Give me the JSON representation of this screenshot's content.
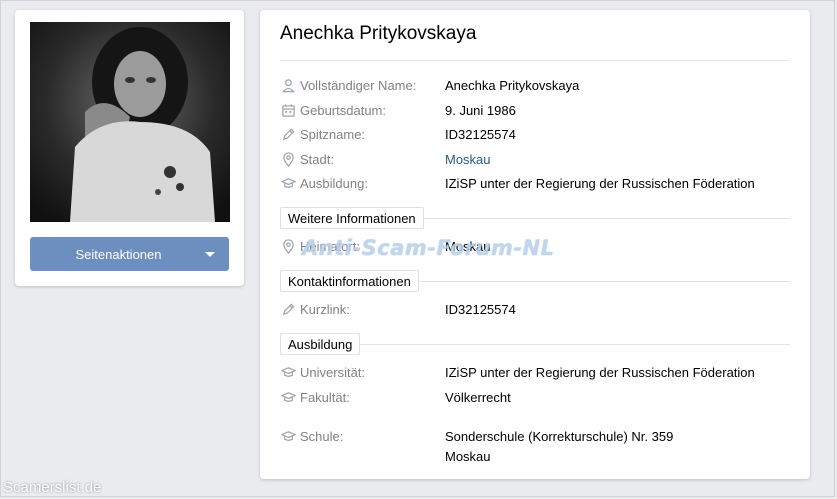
{
  "profile": {
    "name": "Anechka Pritykovskaya",
    "actions_label": "Seitenaktionen"
  },
  "main": [
    {
      "icon": "user-icon",
      "label": "Vollständiger Name:",
      "value": "Anechka Pritykovskaya",
      "link": false
    },
    {
      "icon": "calendar-icon",
      "label": "Geburtsdatum:",
      "value": "9. Juni 1986",
      "link": false
    },
    {
      "icon": "pencil-icon",
      "label": "Spitzname:",
      "value": "ID32125574",
      "link": false
    },
    {
      "icon": "location-pin-icon",
      "label": "Stadt:",
      "value": "Moskau",
      "link": true
    },
    {
      "icon": "graduation-cap-icon",
      "label": "Ausbildung:",
      "value": "IZiSP unter der Regierung der Russischen Föderation",
      "link": false
    }
  ],
  "sections": {
    "more_info": {
      "title": "Weitere Informationen",
      "rows": [
        {
          "icon": "location-pin-icon",
          "label": "Heimatort:",
          "value": "Moskau"
        }
      ]
    },
    "contact": {
      "title": "Kontaktinformationen",
      "rows": [
        {
          "icon": "pencil-icon",
          "label": "Kurzlink:",
          "value": "ID32125574"
        }
      ]
    },
    "education": {
      "title": "Ausbildung",
      "rows": [
        {
          "icon": "graduation-cap-icon",
          "label": "Universität:",
          "value": "IZiSP unter der Regierung der Russischen Föderation"
        },
        {
          "icon": "graduation-cap-icon",
          "label": "Fakultät:",
          "value": "Völkerrecht"
        },
        {
          "icon": "graduation-cap-icon",
          "label": "Schule:",
          "value": "Sonderschule (Korrekturschule) Nr. 359",
          "value2": "Moskau"
        }
      ]
    }
  },
  "watermark": "Anti-Scam-Forum-NL",
  "footer_watermark": "Scamerslist.de",
  "colors": {
    "accent": "#6d8fbf",
    "link": "#2a5885",
    "label": "#828282"
  }
}
